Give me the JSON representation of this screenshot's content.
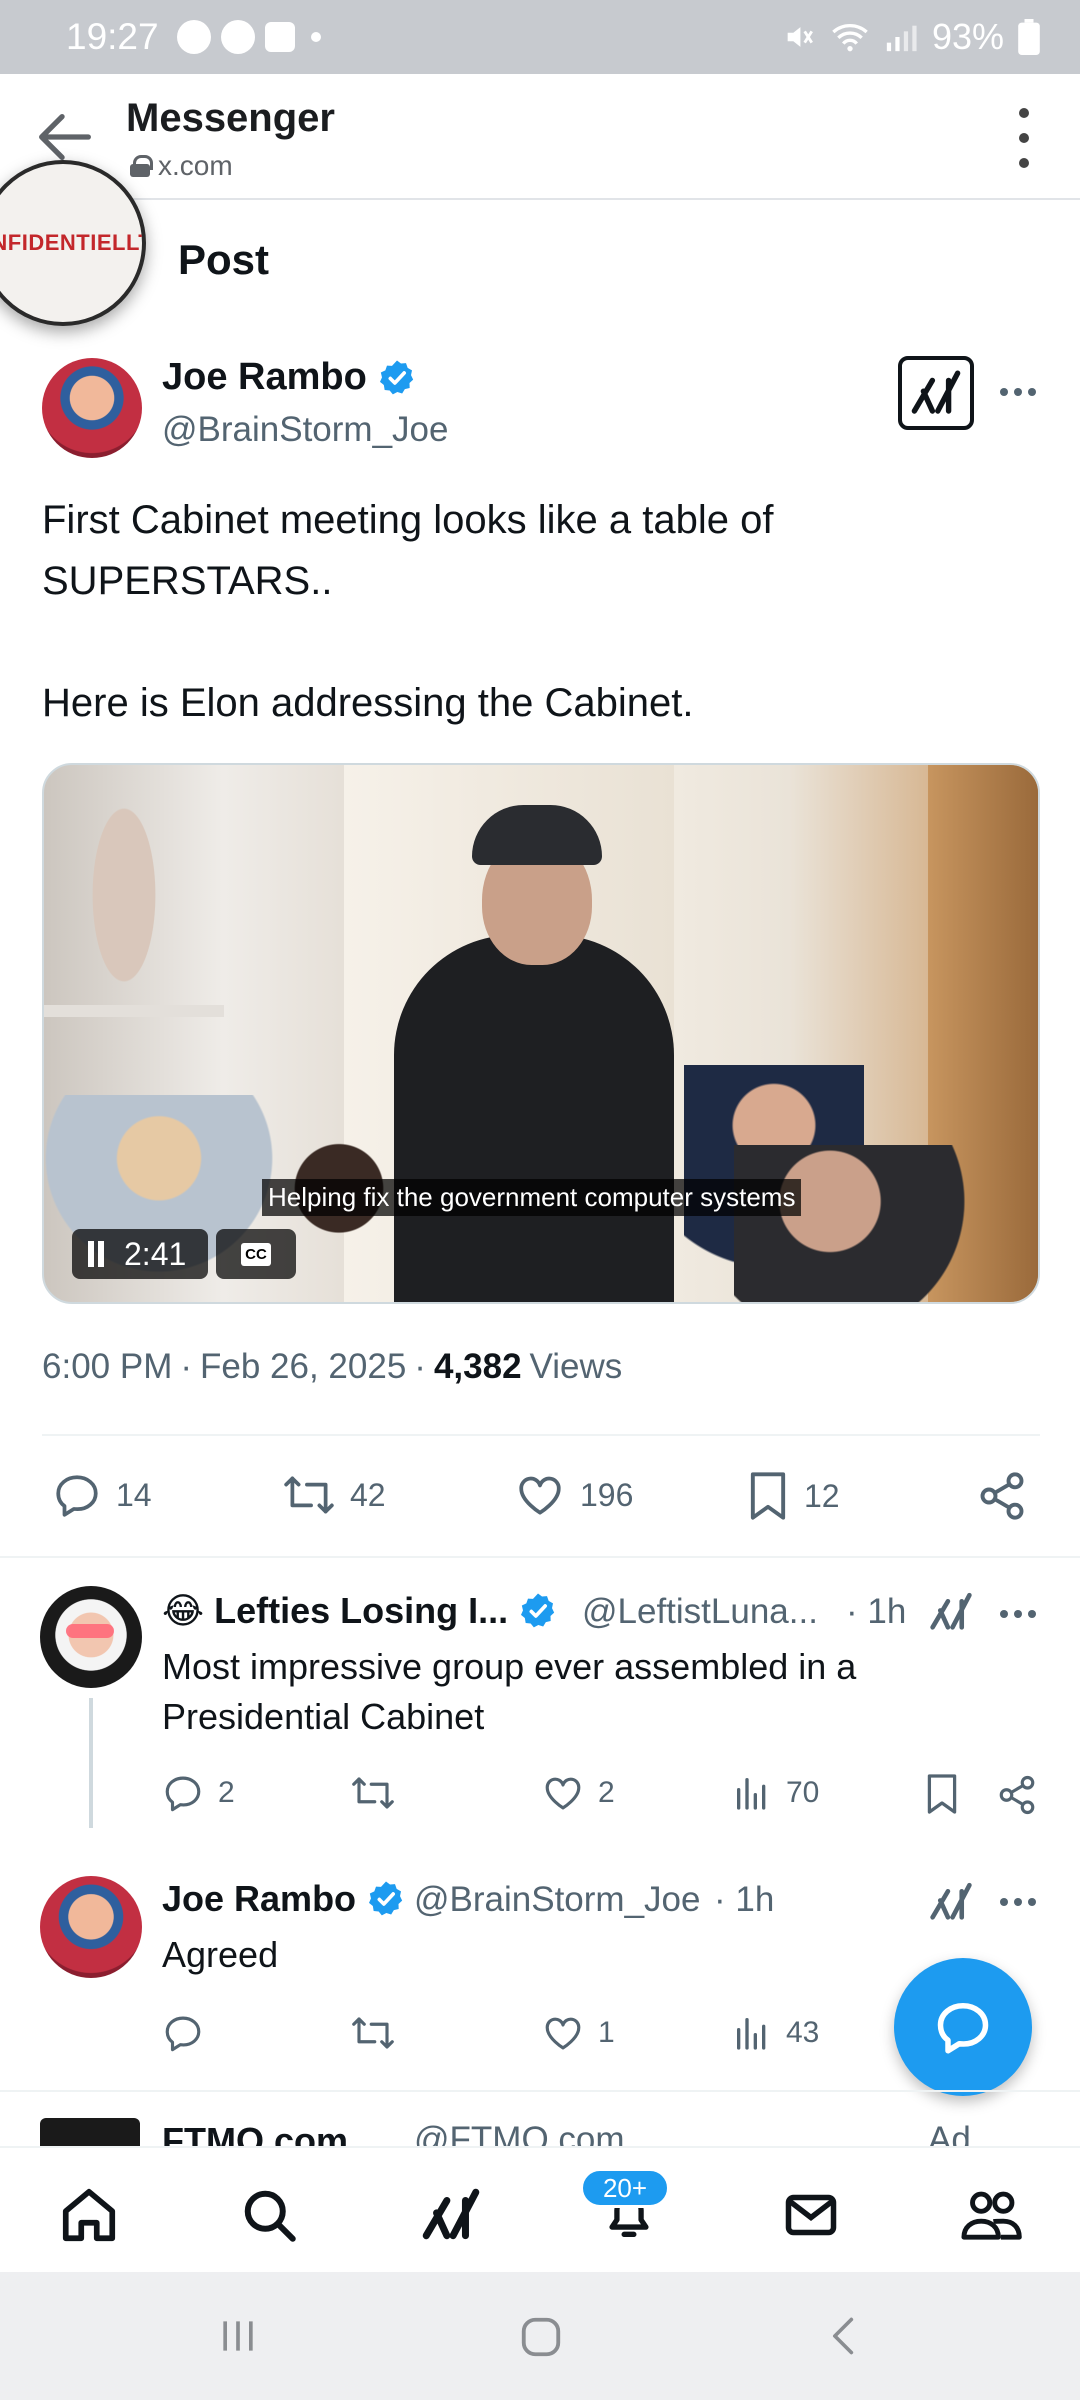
{
  "status_bar": {
    "time": "19:27",
    "battery": "93%"
  },
  "browser": {
    "title": "Messenger",
    "url": "x.com"
  },
  "overlay_badge": {
    "text": "ONFIDENTIELLT"
  },
  "page": {
    "heading": "Post"
  },
  "post": {
    "author_name": "Joe Rambo",
    "author_handle": "@BrainStorm_Joe",
    "text": "First Cabinet meeting looks like a table of\nSUPERSTARS..\n\nHere is Elon addressing the Cabinet.",
    "video": {
      "caption": "Helping fix the government computer systems",
      "time_remaining": "2:41",
      "cc_label": "CC"
    },
    "time": "6:00 PM",
    "date": "Feb 26, 2025",
    "views_count": "4,382",
    "views_label": "Views",
    "stats": {
      "replies": "14",
      "reposts": "42",
      "likes": "196",
      "bookmarks": "12"
    }
  },
  "replies": [
    {
      "emoji": "😂",
      "name": "Lefties Losing I...",
      "handle": "@LeftistLuna...",
      "age": "· 1h",
      "text": "Most impressive group ever assembled in a\nPresidential Cabinet",
      "replies": "2",
      "reposts": "",
      "likes": "2",
      "views": "70"
    },
    {
      "name": "Joe Rambo",
      "handle": "@BrainStorm_Joe",
      "age": "· 1h",
      "text": "Agreed",
      "replies": "",
      "reposts": "",
      "likes": "1",
      "views": "43"
    }
  ],
  "partial_item": {
    "name": "FTMO.com",
    "handle": "@FTMO.com",
    "label": "Ad"
  },
  "bottom_nav": {
    "notifications_badge": "20+"
  },
  "colors": {
    "accent": "#1d9bf0",
    "text_primary": "#0f1419",
    "text_secondary": "#536471",
    "status_bar_bg": "#c7cacf"
  },
  "icons": [
    "back-arrow-icon",
    "lock-icon",
    "kebab-menu-icon",
    "verified-badge-icon",
    "grok-icon",
    "more-icon",
    "reply-icon",
    "repost-icon",
    "like-icon",
    "bookmark-icon",
    "share-icon",
    "views-icon",
    "compose-icon",
    "home-icon",
    "search-icon",
    "bell-icon",
    "mail-icon",
    "communities-icon"
  ]
}
